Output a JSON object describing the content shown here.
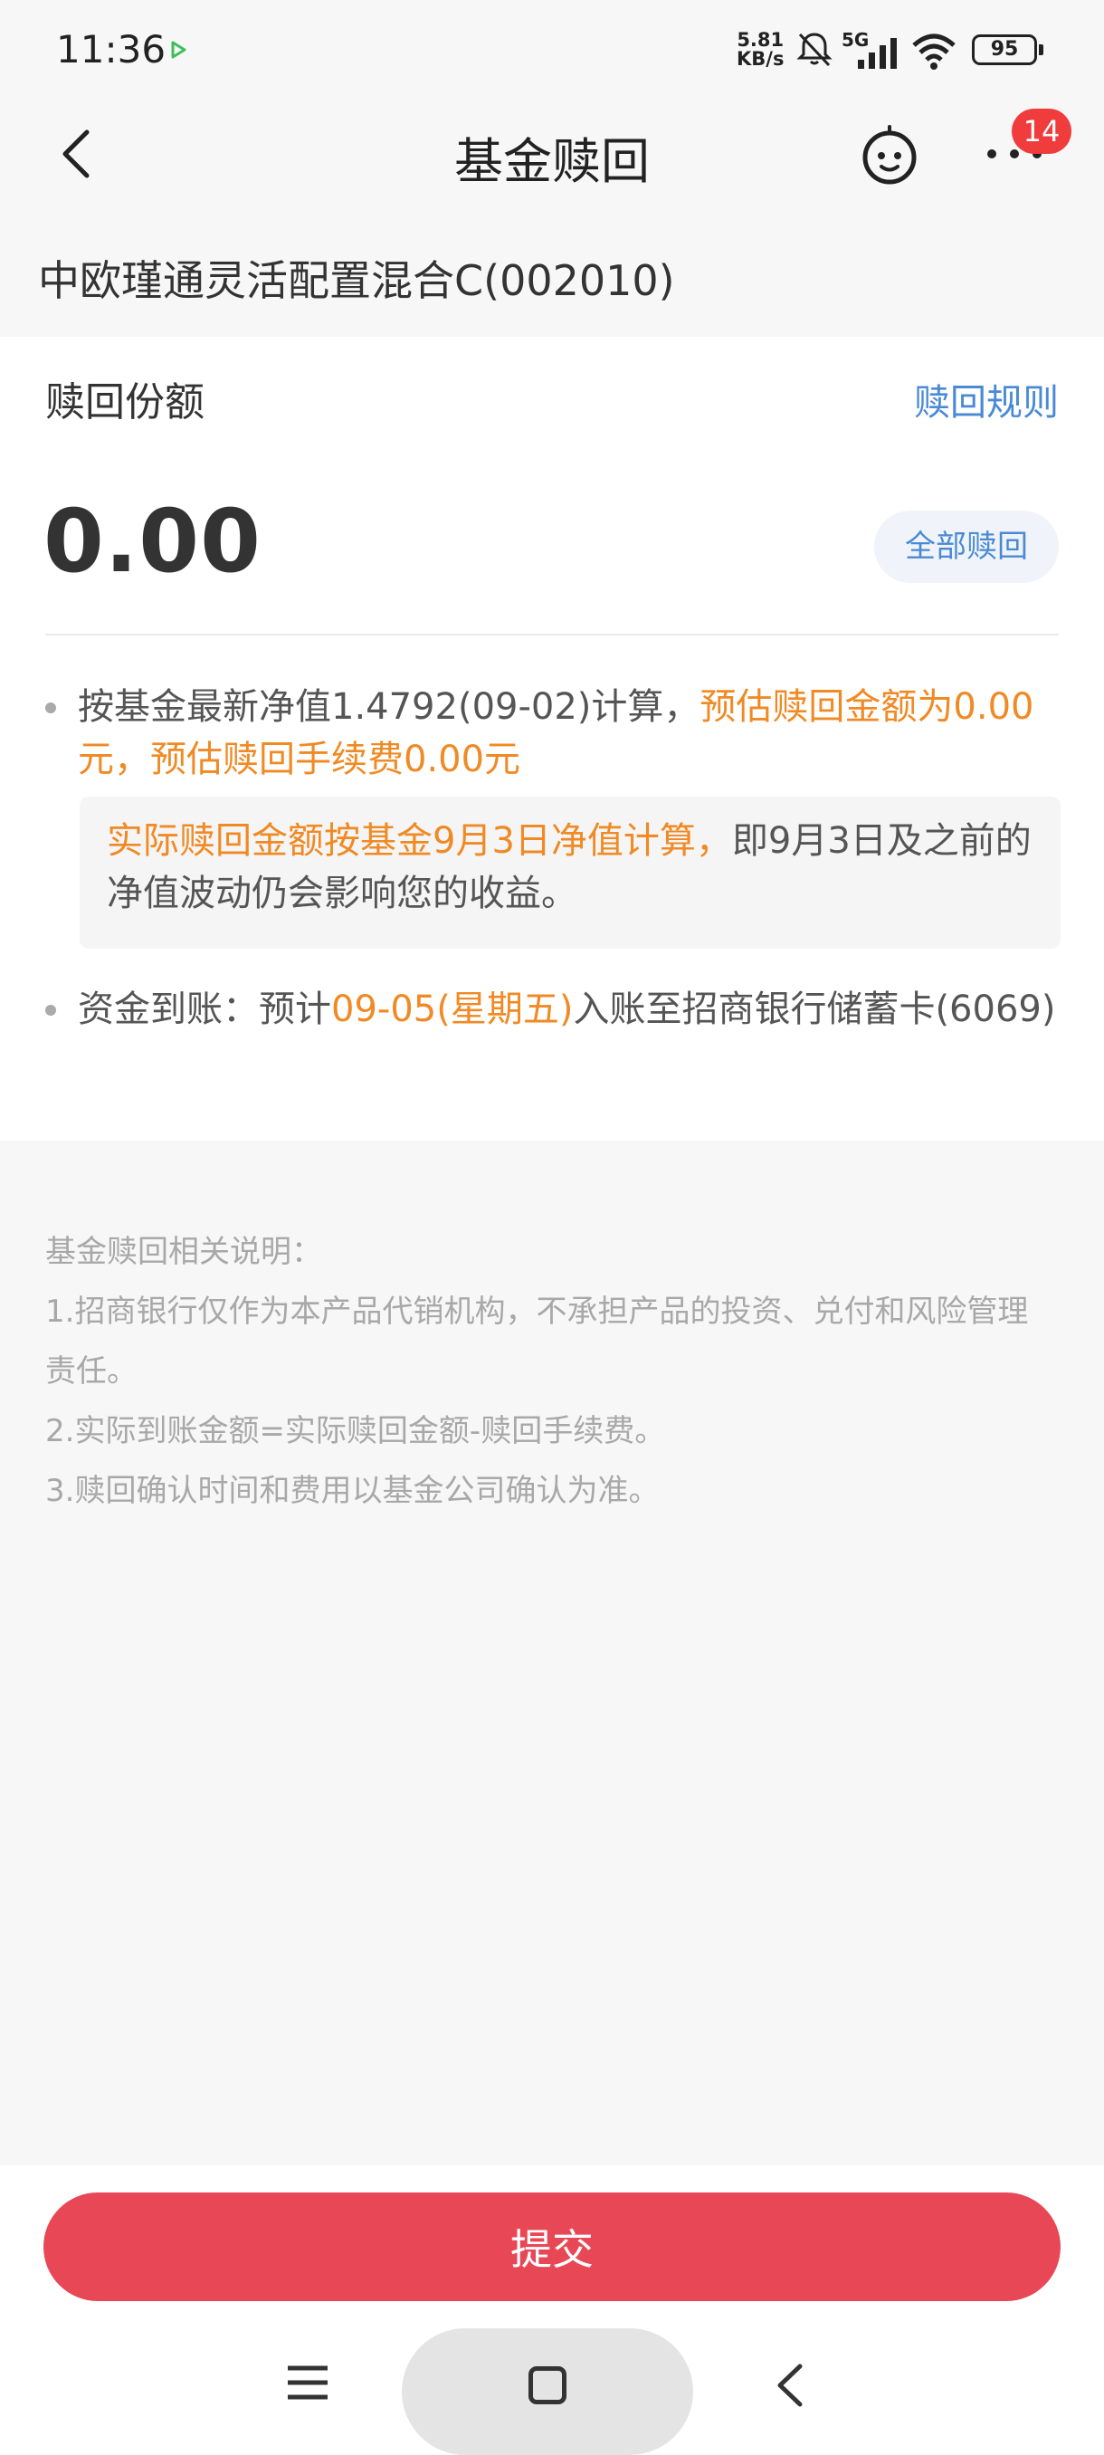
{
  "status_bar": {
    "time": "11:36",
    "net_speed_value": "5.81",
    "net_speed_unit": "KB/s",
    "network": "5G",
    "battery": "95"
  },
  "nav": {
    "title": "基金赎回",
    "badge_count": "14"
  },
  "fund": {
    "name": "中欧瑾通灵活配置混合C(002010)"
  },
  "redeem": {
    "section_title": "赎回份额",
    "rules_link": "赎回规则",
    "amount": "0.00",
    "redeem_all_label": "全部赎回"
  },
  "info": {
    "nav_calc_text": "按基金最新净值1.4792(09-02)计算，",
    "estimate_text": "预估赎回金额为0.00元，预估赎回手续费0.00元",
    "notice_highlight": "实际赎回金额按基金9月3日净值计算，",
    "notice_rest": "即9月3日及之前的净值波动仍会影响您的收益。",
    "arrival_prefix": "资金到账：预计",
    "arrival_date": "09-05(星期五)",
    "arrival_suffix": "入账至招商银行储蓄卡(6069)"
  },
  "explanation": {
    "heading": "基金赎回相关说明：",
    "items": [
      "1.招商银行仅作为本产品代销机构，不承担产品的投资、兑付和风险管理责任。",
      "2.实际到账金额=实际赎回金额-赎回手续费。",
      "3.赎回确认时间和费用以基金公司确认为准。"
    ]
  },
  "actions": {
    "submit_label": "提交"
  },
  "colors": {
    "accent_blue": "#4a8ad4",
    "highlight_orange": "#f08a24",
    "submit_red": "#e84856",
    "badge_red": "#f03c3c"
  },
  "icons": {
    "back": "chevron-left-icon",
    "bot": "smiley-bot-icon",
    "more": "more-dots-icon",
    "play": "play-icon",
    "mute": "bell-muted-icon",
    "signal": "signal-bars-icon",
    "wifi": "wifi-icon",
    "battery": "battery-icon",
    "menu": "menu-lines-icon",
    "home": "home-square-icon",
    "sys_back": "back-chevron-icon"
  }
}
